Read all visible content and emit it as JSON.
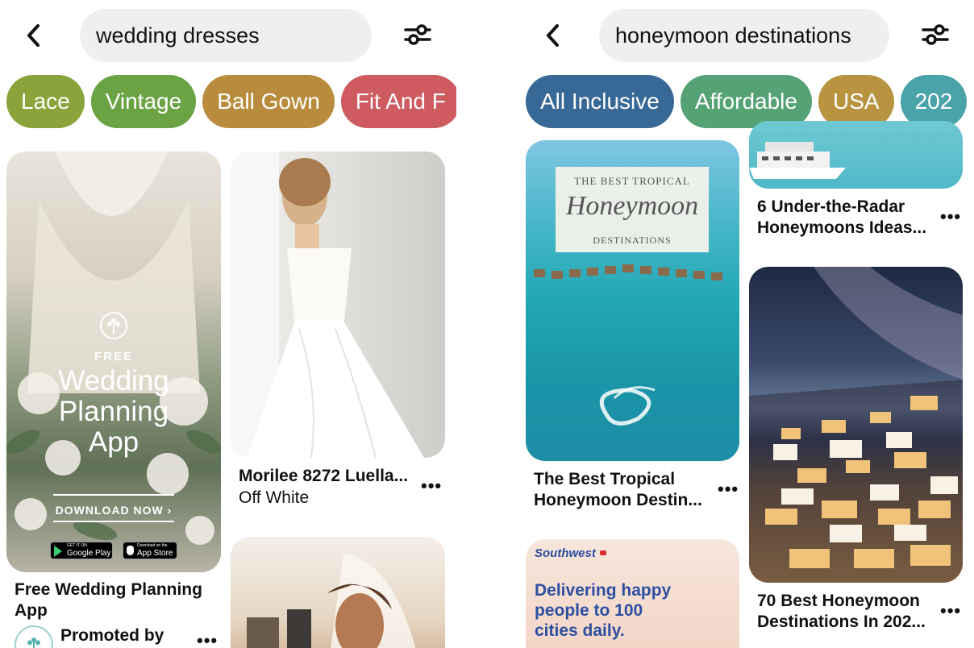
{
  "left": {
    "search_value": "wedding dresses",
    "chips": [
      {
        "label": "Lace",
        "color": "#8aa33a"
      },
      {
        "label": "Vintage",
        "color": "#6aa244"
      },
      {
        "label": "Ball Gown",
        "color": "#b88c3c"
      },
      {
        "label": "Fit And F",
        "color": "#cd5b5f"
      }
    ],
    "pin1": {
      "ad_free": "FREE",
      "ad_line1": "Wedding",
      "ad_line2": "Planning",
      "ad_line3": "App",
      "ad_cta": "DOWNLOAD NOW ›",
      "google_small": "GET IT ON",
      "google_label": "Google Play",
      "apple_small": "Download on the",
      "apple_label": "App Store",
      "title_line1": "Free Wedding Planning",
      "title_line2": "App",
      "promoted": "Promoted by"
    },
    "pin2": {
      "title": "Morilee 8272 Luella...",
      "subtitle": "Off White"
    }
  },
  "right": {
    "search_value": "honeymoon destinations",
    "chips": [
      {
        "label": "All Inclusive",
        "color": "#386896"
      },
      {
        "label": "Affordable",
        "color": "#55a275"
      },
      {
        "label": "USA",
        "color": "#b89440"
      },
      {
        "label": "202",
        "color": "#4aa3a8"
      }
    ],
    "pin1": {
      "overlay_top": "THE BEST TROPICAL",
      "overlay_script": "Honeymoon",
      "overlay_bottom": "DESTINATIONS",
      "title_line1": "The Best Tropical",
      "title_line2": "Honeymoon Destin..."
    },
    "pin2": {
      "title_line1": "6 Under-the-Radar",
      "title_line2": "Honeymoons Ideas..."
    },
    "pin3": {
      "title_line1": "70 Best Honeymoon",
      "title_line2": "Destinations In 202..."
    },
    "pin4": {
      "brand": "Southwest",
      "line1": "Delivering happy",
      "line2": "people to 100",
      "line3": "cities daily."
    }
  },
  "more_glyph": "•••",
  "icons": [
    "chevron-left-icon",
    "filter-sliders-icon",
    "more-icon",
    "heart-flower-icon",
    "google-play-icon",
    "apple-icon"
  ]
}
